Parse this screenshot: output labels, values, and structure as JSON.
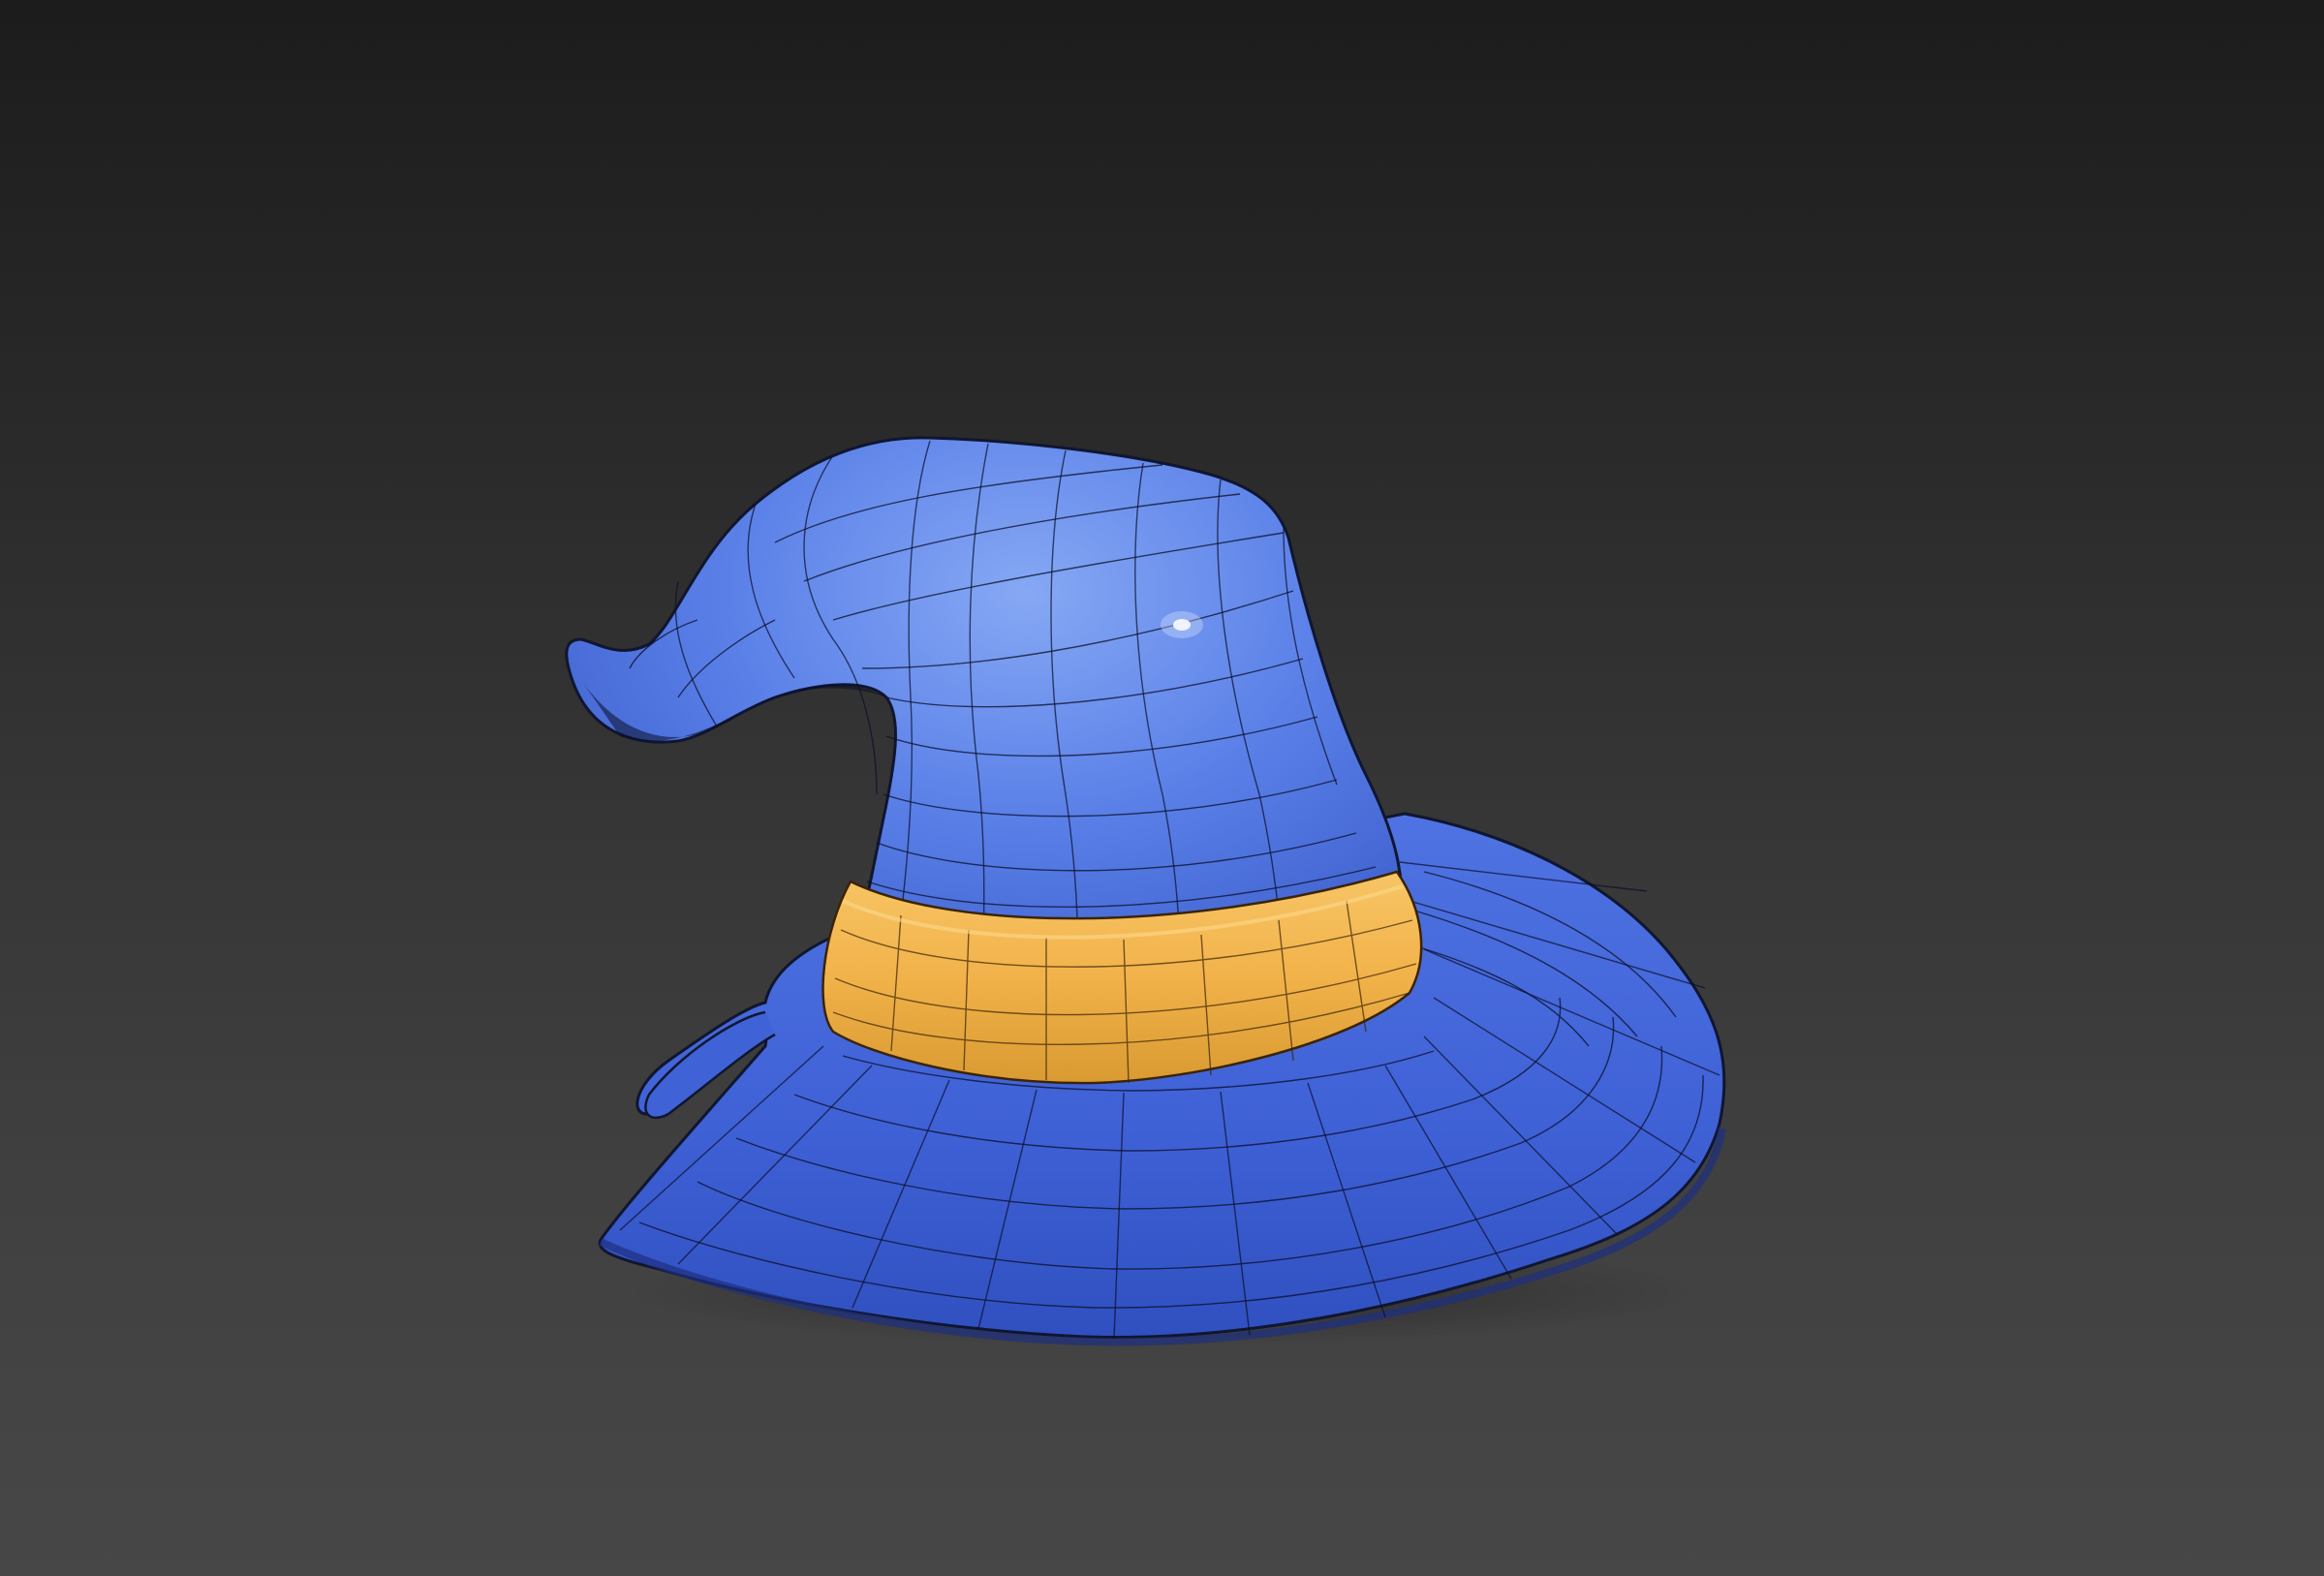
{
  "scene": {
    "subject": "wizard-hat-wireframe-model",
    "colors": {
      "background_top": "#1c1c1c",
      "background_bottom": "#474747",
      "hat_body": "#4a6ee0",
      "hat_light": "#7a9ff0",
      "hat_dark": "#2f49b0",
      "band": "#f3b64c",
      "band_dark": "#d89a30",
      "wire": "#0a0f2a"
    }
  }
}
